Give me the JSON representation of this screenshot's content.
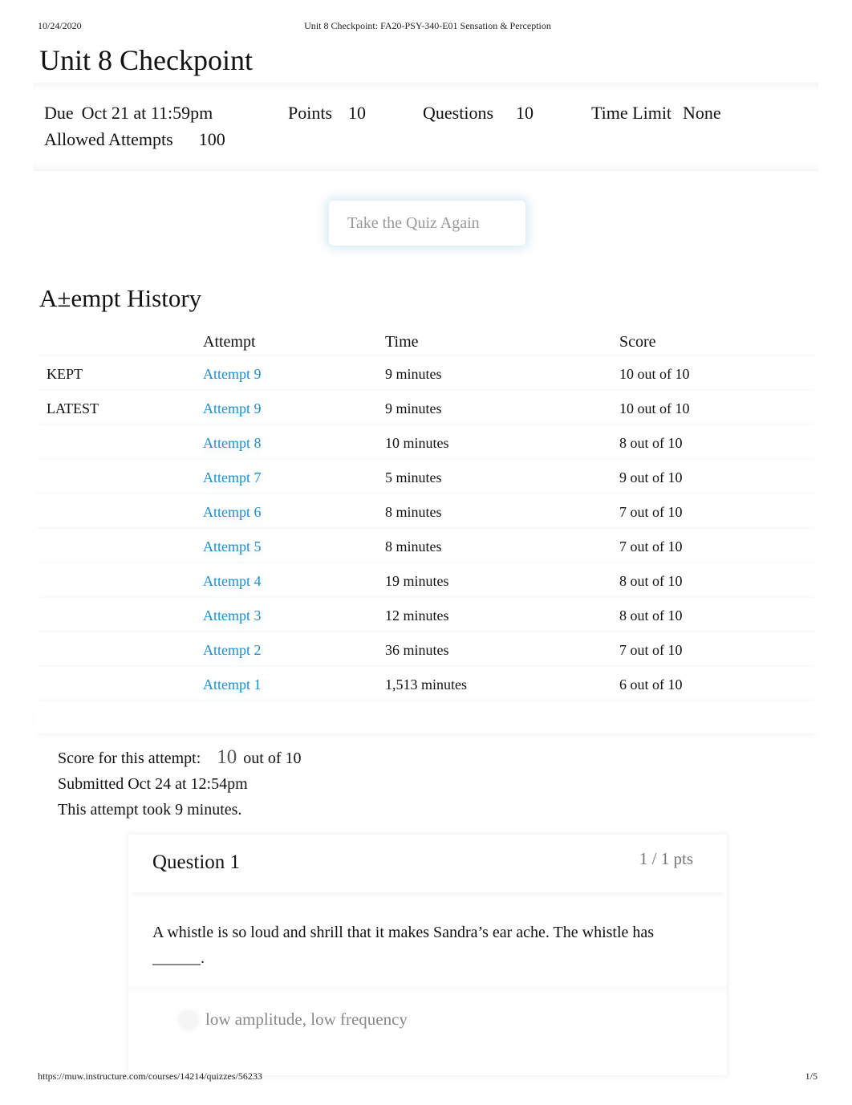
{
  "print_header": {
    "date": "10/24/2020",
    "doc_title": "Unit 8 Checkpoint: FA20-PSY-340-E01 Sensation & Perception"
  },
  "page_title": "Unit 8 Checkpoint",
  "quiz_info": {
    "due_label": "Due",
    "due_value": "Oct 21 at 11:59pm",
    "points_label": "Points",
    "points_value": "10",
    "questions_label": "Questions",
    "questions_value": "10",
    "time_limit_label": "Time Limit",
    "time_limit_value": "None",
    "allowed_attempts_label": "Allowed Attempts",
    "allowed_attempts_value": "100"
  },
  "retake_button": "Take the Quiz Again",
  "attempt_history": {
    "title": "A±empt History",
    "headers": [
      "",
      "Attempt",
      "Time",
      "Score"
    ],
    "rows": [
      {
        "tag": "KEPT",
        "attempt": "Attempt 9",
        "time": "9 minutes",
        "score": "10 out of 10"
      },
      {
        "tag": "LATEST",
        "attempt": "Attempt 9",
        "time": "9 minutes",
        "score": "10 out of 10"
      },
      {
        "tag": "",
        "attempt": "Attempt 8",
        "time": "10 minutes",
        "score": "8 out of 10"
      },
      {
        "tag": "",
        "attempt": "Attempt 7",
        "time": "5 minutes",
        "score": "9 out of 10"
      },
      {
        "tag": "",
        "attempt": "Attempt 6",
        "time": "8 minutes",
        "score": "7 out of 10"
      },
      {
        "tag": "",
        "attempt": "Attempt 5",
        "time": "8 minutes",
        "score": "7 out of 10"
      },
      {
        "tag": "",
        "attempt": "Attempt 4",
        "time": "19 minutes",
        "score": "8 out of 10"
      },
      {
        "tag": "",
        "attempt": "Attempt 3",
        "time": "12 minutes",
        "score": "8 out of 10"
      },
      {
        "tag": "",
        "attempt": "Attempt 2",
        "time": "36 minutes",
        "score": "7 out of 10"
      },
      {
        "tag": "",
        "attempt": "Attempt 1",
        "time": "1,513 minutes",
        "score": "6 out of 10"
      }
    ]
  },
  "attempt_summary": {
    "score_label": "Score for this attempt:",
    "score_value": "10",
    "score_suffix": "out of 10",
    "submitted": "Submitted Oct 24 at 12:54pm",
    "duration": "This attempt took 9 minutes."
  },
  "question": {
    "title": "Question 1",
    "points": "1 / 1 pts",
    "text": "A whistle is so loud and shrill that it makes Sandra’s ear ache. The whistle has ______.",
    "answers": [
      "low amplitude, low frequency"
    ]
  },
  "print_footer": {
    "url": "https://muw.instructure.com/courses/14214/quizzes/56233",
    "page": "1/5"
  }
}
